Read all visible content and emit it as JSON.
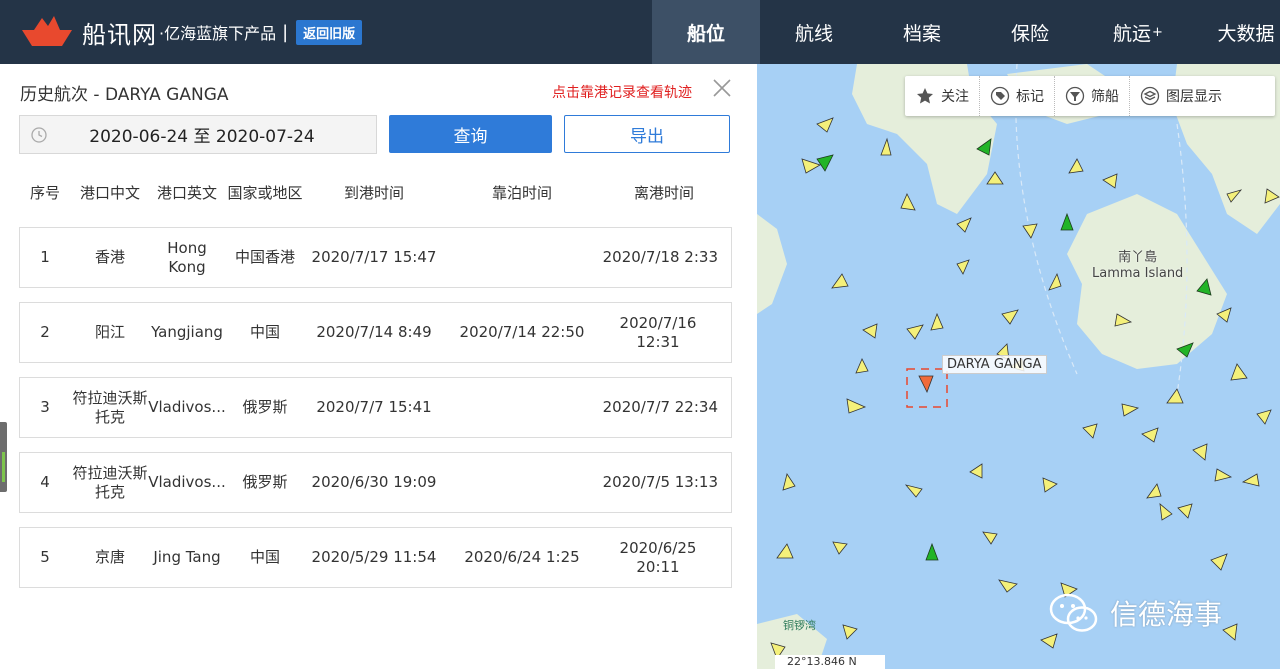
{
  "header": {
    "brand": "船讯网",
    "subtitle": "·亿海蓝旗下产品",
    "separator": "|",
    "old_version_label": "返回旧版",
    "nav": [
      {
        "label": "船位",
        "active": true
      },
      {
        "label": "航线",
        "active": false
      },
      {
        "label": "档案",
        "active": false
      },
      {
        "label": "保险",
        "active": false
      },
      {
        "label": "航运",
        "sup": "+",
        "active": false
      },
      {
        "label": "大数据",
        "active": false
      }
    ]
  },
  "panel": {
    "title": "历史航次 - DARYA GANGA",
    "hint": "点击靠港记录查看轨迹",
    "date_range": "2020-06-24 至 2020-07-24",
    "query_label": "查询",
    "export_label": "导出",
    "columns": [
      "序号",
      "港口中文",
      "港口英文",
      "国家或地区",
      "到港时间",
      "靠泊时间",
      "离港时间"
    ],
    "rows": [
      {
        "no": "1",
        "port_cn": "香港",
        "port_en": "Hong Kong",
        "country": "中国香港",
        "arrive": "2020/7/17 15:47",
        "berth": "",
        "depart": "2020/7/18 2:33"
      },
      {
        "no": "2",
        "port_cn": "阳江",
        "port_en": "Yangjiang",
        "country": "中国",
        "arrive": "2020/7/14 8:49",
        "berth": "2020/7/14 22:50",
        "depart": "2020/7/16 12:31"
      },
      {
        "no": "3",
        "port_cn": "符拉迪沃斯托克",
        "port_en": "Vladivos...",
        "country": "俄罗斯",
        "arrive": "2020/7/7 15:41",
        "berth": "",
        "depart": "2020/7/7 22:34"
      },
      {
        "no": "4",
        "port_cn": "符拉迪沃斯托克",
        "port_en": "Vladivos...",
        "country": "俄罗斯",
        "arrive": "2020/6/30 19:09",
        "berth": "",
        "depart": "2020/7/5 13:13"
      },
      {
        "no": "5",
        "port_cn": "京唐",
        "port_en": "Jing Tang",
        "country": "中国",
        "arrive": "2020/5/29 11:54",
        "berth": "2020/6/24 1:25",
        "depart": "2020/6/25 20:11"
      }
    ]
  },
  "map": {
    "toolbar": [
      {
        "label": "关注",
        "icon": "star-icon"
      },
      {
        "label": "标记",
        "icon": "tag-icon"
      },
      {
        "label": "筛船",
        "icon": "filter-icon"
      },
      {
        "label": "图层显示",
        "icon": "layers-icon"
      }
    ],
    "ship_label": "DARYA GANGA",
    "island_cn": "南丫島",
    "island_en": "Lamma Island",
    "bay_label": "铜锣湾",
    "coord_text": "22°13.846 N",
    "watermark": "信德海事",
    "colors": {
      "water": "#a7d0f5",
      "land": "#e5eedb",
      "ship_cargo": "#f4f07a",
      "ship_other": "#22b427",
      "target": "#f06a3a"
    }
  }
}
